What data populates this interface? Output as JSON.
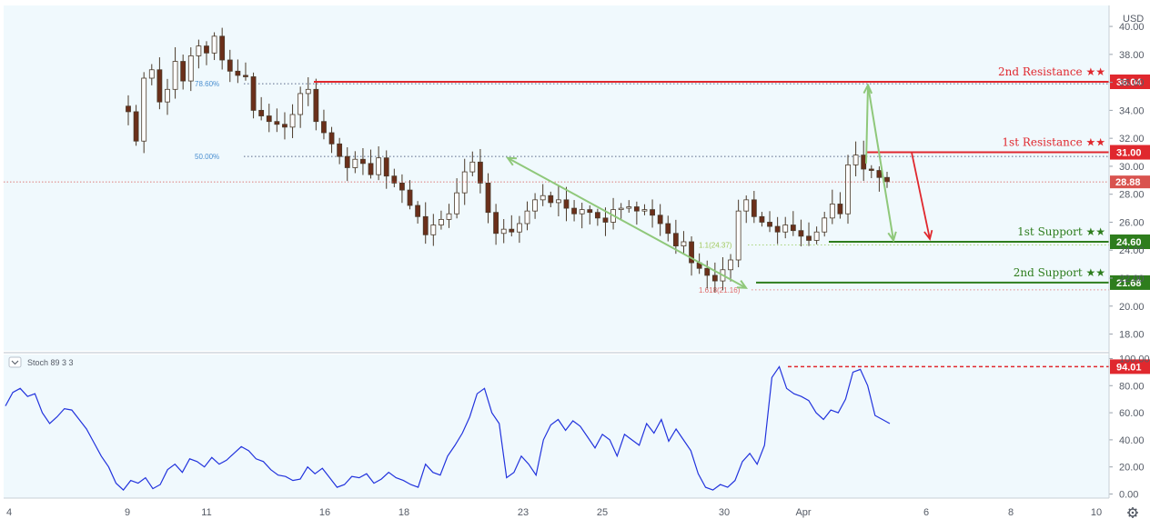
{
  "colors": {
    "background": "#f0f9fd",
    "resistance": "#e0282e",
    "support": "#2e7d1d",
    "fib_label": "#4a8fd0",
    "arrow_green": "#8fc87a",
    "candle_up": "#6b2f1a",
    "stoch_line": "#2233dd",
    "price_badge": "#d9534f"
  },
  "currency_label": "USD",
  "stoch_title": "Stoch 89 3 3",
  "settings_icon": "gear-icon",
  "collapse_icon": "chevron-down-icon",
  "chart_data": [
    {
      "type": "candlestick",
      "title": "",
      "ylabel": "USD",
      "ylim": [
        16.8,
        41.5
      ],
      "y_ticks": [
        "40.00",
        "38.00",
        "36.00",
        "34.00",
        "32.00",
        "30.00",
        "28.00",
        "26.00",
        "24.00",
        "22.00",
        "20.00",
        "18.00"
      ],
      "x_ticks": [
        "4",
        "9",
        "11",
        "16",
        "18",
        "23",
        "25",
        "30",
        "Apr",
        "6",
        "8",
        "10"
      ],
      "last_price": "28.88",
      "levels": [
        {
          "name": "2nd Resistance ★★",
          "value": "36.04",
          "kind": "resistance"
        },
        {
          "name": "1st Resistance ★★",
          "value": "31.00",
          "kind": "resistance"
        },
        {
          "name": "1st Support ★★",
          "value": "24.60",
          "kind": "support"
        },
        {
          "name": "2nd Support ★★",
          "value": "21.68",
          "kind": "support"
        }
      ],
      "fib_labels": [
        {
          "text": "78.60%",
          "value": 35.9
        },
        {
          "text": "50.00%",
          "value": 30.7
        },
        {
          "text": "1.1(24.37)",
          "value": 24.37
        },
        {
          "text": "1.618(21.16)",
          "value": 21.16
        }
      ],
      "close_series": [
        33.9,
        31.8,
        36.3,
        36.9,
        34.6,
        35.5,
        37.5,
        36.1,
        37.9,
        38.6,
        38.1,
        39.3,
        37.6,
        36.8,
        36.5,
        36.4,
        34.0,
        33.6,
        33.2,
        33.0,
        32.8,
        33.7,
        35.2,
        35.5,
        33.2,
        32.4,
        31.6,
        30.7,
        29.9,
        30.5,
        30.2,
        29.4,
        30.6,
        29.3,
        28.8,
        28.3,
        27.2,
        26.4,
        25.1,
        25.8,
        26.2,
        26.6,
        28.1,
        29.6,
        30.3,
        28.8,
        26.7,
        25.2,
        25.5,
        25.3,
        25.9,
        26.8,
        27.6,
        27.9,
        27.4,
        27.6,
        27.0,
        26.6,
        26.9,
        26.7,
        26.3,
        26.0,
        26.9,
        27.0,
        27.1,
        26.8,
        26.9,
        26.5,
        25.9,
        25.2,
        24.3,
        24.6,
        23.1,
        22.7,
        22.2,
        21.8,
        22.6,
        23.3,
        26.8,
        27.6,
        26.4,
        26.0,
        25.7,
        25.3,
        25.8,
        25.4,
        25.0,
        24.7,
        25.3,
        26.3,
        27.3,
        26.6,
        30.1,
        30.8,
        29.8,
        29.7,
        29.2,
        28.9
      ],
      "series_y_range_values": {
        "start": 33.9,
        "end": 28.88
      }
    },
    {
      "type": "line",
      "title": "",
      "ylabel": "",
      "ylim": [
        -3,
        103
      ],
      "y_ticks": [
        "100.00",
        "80.00",
        "60.00",
        "40.00",
        "20.00",
        "0.00"
      ],
      "last_value": "94.01",
      "level_value": 94.01,
      "values": [
        65,
        75,
        78,
        72,
        74,
        60,
        52,
        57,
        63,
        62,
        55,
        48,
        38,
        28,
        20,
        8,
        3,
        10,
        8,
        12,
        4,
        7,
        18,
        22,
        16,
        26,
        24,
        20,
        27,
        22,
        25,
        30,
        35,
        32,
        26,
        24,
        18,
        14,
        13,
        10,
        11,
        20,
        15,
        19,
        12,
        5,
        7,
        13,
        12,
        15,
        8,
        11,
        16,
        12,
        10,
        7,
        5,
        22,
        16,
        14,
        28,
        36,
        45,
        57,
        74,
        78,
        60,
        52,
        12,
        16,
        28,
        22,
        14,
        40,
        51,
        55,
        47,
        54,
        50,
        42,
        34,
        44,
        40,
        28,
        44,
        40,
        36,
        52,
        45,
        55,
        39,
        48,
        40,
        32,
        15,
        5,
        3,
        7,
        5,
        10,
        24,
        30,
        22,
        36,
        86,
        94,
        78,
        74,
        72,
        69,
        60,
        55,
        62,
        60,
        70,
        90,
        92,
        80,
        58,
        55,
        52
      ]
    }
  ]
}
